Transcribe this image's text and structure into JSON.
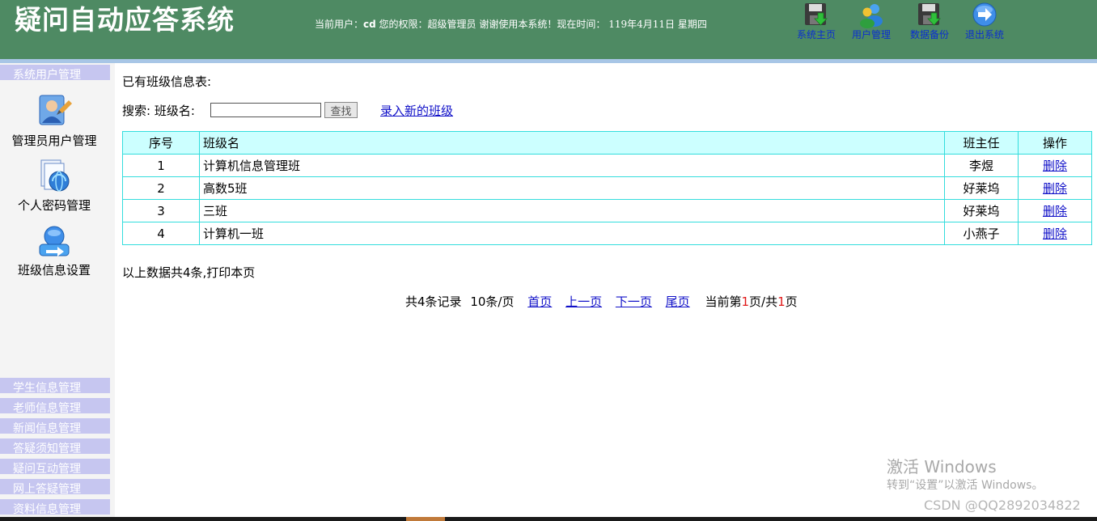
{
  "header": {
    "app_title": "疑问自动应答系统",
    "status_prefix": "当前用户：",
    "user": "cd",
    "role_text": "您的权限：超级管理员 谢谢使用本系统！现在时间：",
    "datetime": "119年4月11日 星期四",
    "colors": {
      "header_bg": "#4e8a63",
      "band": "#a8c6e6",
      "link": "#0b2fd0"
    },
    "nav": [
      {
        "label": "系统主页",
        "icon": "disk-save-icon"
      },
      {
        "label": "用户管理",
        "icon": "users-icon"
      },
      {
        "label": "数据备份",
        "icon": "disk-save-icon"
      },
      {
        "label": "退出系统",
        "icon": "arrow-exit-icon"
      }
    ]
  },
  "sidebar": {
    "top_group": "系统用户管理",
    "items": [
      {
        "label": "管理员用户管理",
        "icon": "admin-user-icon"
      },
      {
        "label": "个人密码管理",
        "icon": "password-doc-icon"
      },
      {
        "label": "班级信息设置",
        "icon": "class-setting-icon"
      }
    ],
    "groups": [
      "学生信息管理",
      "老师信息管理",
      "新闻信息管理",
      "答疑须知管理",
      "疑问互动管理",
      "网上答疑管理",
      "资料信息管理"
    ]
  },
  "main": {
    "heading": "已有班级信息表:",
    "search_label": "搜索: 班级名:",
    "search_value": "",
    "search_button": "查找",
    "add_link": "录入新的班级",
    "table": {
      "headers": [
        "序号",
        "班级名",
        "班主任",
        "操作"
      ],
      "rows": [
        {
          "no": "1",
          "name": "计算机信息管理班",
          "teacher": "李煜",
          "op": "删除"
        },
        {
          "no": "2",
          "name": "高数5班",
          "teacher": "好莱坞",
          "op": "删除"
        },
        {
          "no": "3",
          "name": "三班",
          "teacher": "好莱坞",
          "op": "删除"
        },
        {
          "no": "4",
          "name": "计算机一班",
          "teacher": "小燕子",
          "op": "删除"
        }
      ]
    },
    "summary": "以上数据共4条,打印本页",
    "pager": {
      "total": "共4条记录",
      "per_page": "10条/页",
      "first": "首页",
      "prev": "上一页",
      "next": "下一页",
      "last": "尾页",
      "cur_prefix": "当前第",
      "cur_page": "1",
      "cur_mid": "页/共",
      "total_pages": "1",
      "cur_suffix": "页"
    }
  },
  "watermark": {
    "line1": "激活 Windows",
    "line2": "转到“设置”以激活 Windows。",
    "csdn": "CSDN @QQ2892034822"
  }
}
